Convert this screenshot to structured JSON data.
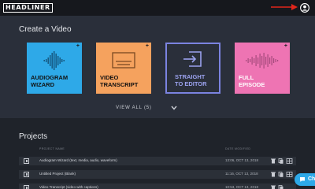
{
  "header": {
    "logo": "HEADLINER"
  },
  "create": {
    "title": "Create a Video",
    "cards": [
      {
        "label_line1": "AUDIOGRAM",
        "label_line2": "WIZARD",
        "plus": "+"
      },
      {
        "label_line1": "VIDEO",
        "label_line2": "TRANSCRIPT",
        "plus": "+"
      },
      {
        "label_line1": "STRAIGHT",
        "label_line2": "TO EDITOR"
      },
      {
        "label_line1": "FULL",
        "label_line2": "EPISODE",
        "plus": "+"
      }
    ],
    "view_all": "VIEW ALL (5)"
  },
  "projects": {
    "title": "Projects",
    "columns": {
      "name": "PROJECT NAME",
      "date": "DATE MODIFIED"
    },
    "rows": [
      {
        "name": "Audiogram Wizard (text, media, audio, waveform)",
        "date": "13:06, OCT 13, 2018"
      },
      {
        "name": "Untitled Project (Blank)",
        "date": "11:16, OCT 13, 2018"
      },
      {
        "name": "Video Transcript (video with captions)",
        "date": "10:53, OCT 13, 2018"
      }
    ]
  },
  "chat": {
    "label": "Ch"
  },
  "colors": {
    "audiogram": "#2ea9e8",
    "transcript": "#f5a25e",
    "editor_border": "#7b83e0",
    "episode": "#ee74b3",
    "arrow": "#e0261b"
  }
}
